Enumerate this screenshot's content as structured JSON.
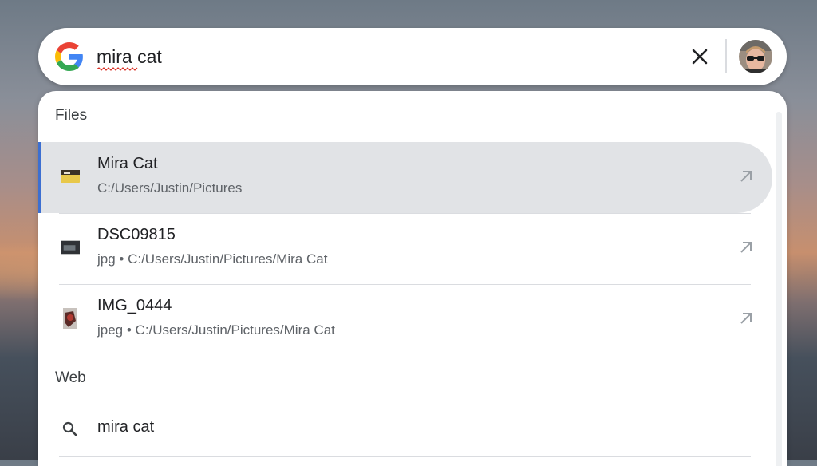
{
  "search": {
    "query": "mira cat"
  },
  "sections": {
    "files_label": "Files",
    "web_label": "Web"
  },
  "files": [
    {
      "title": "Mira Cat",
      "subtitle": "C:/Users/Justin/Pictures",
      "selected": true
    },
    {
      "title": "DSC09815",
      "subtitle": "jpg • C:/Users/Justin/Pictures/Mira Cat",
      "selected": false
    },
    {
      "title": "IMG_0444",
      "subtitle": "jpeg • C:/Users/Justin/Pictures/Mira Cat",
      "selected": false
    }
  ],
  "web": [
    {
      "text": "mira cat"
    }
  ],
  "icons": {
    "logo": "google-g-icon",
    "clear": "close-icon",
    "open": "arrow-up-right-icon",
    "folder": "folder-icon",
    "search": "search-icon",
    "avatar": "user-avatar"
  },
  "colors": {
    "accent": "#3c6fd1",
    "selected_bg": "#e1e3e6"
  }
}
